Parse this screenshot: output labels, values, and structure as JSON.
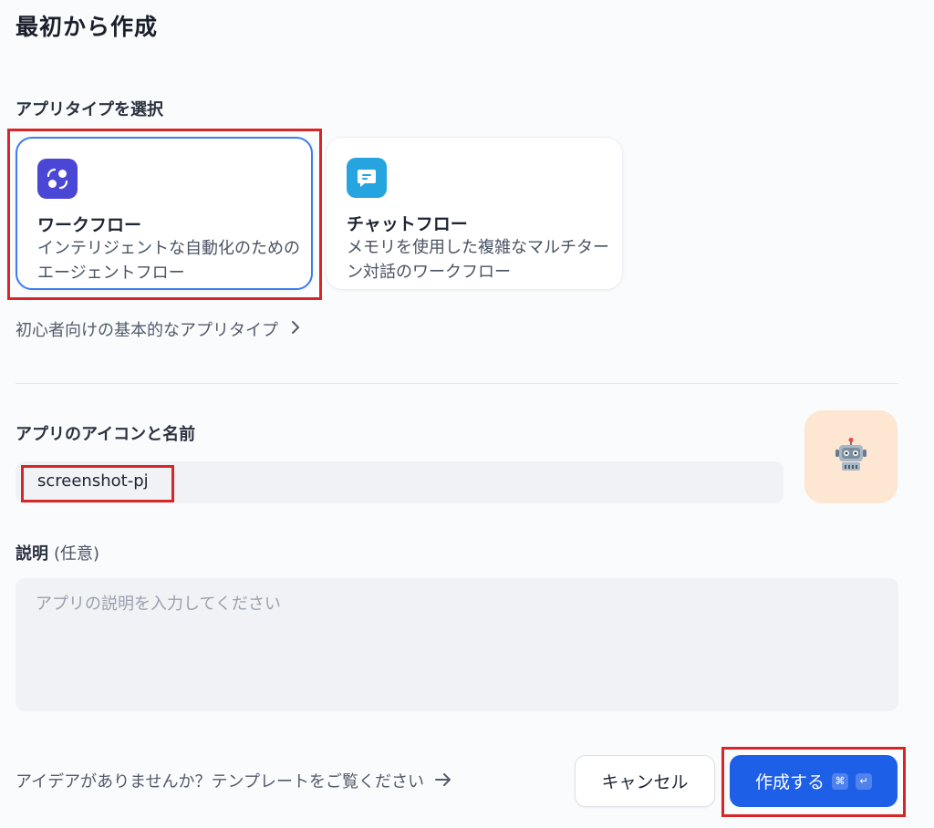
{
  "header": {
    "title": "最初から作成"
  },
  "app_type": {
    "label": "アプリタイプを選択",
    "cards": [
      {
        "name": "ワークフロー",
        "desc": "インテリジェントな自動化のためのエージェントフロー",
        "icon": "workflow-icon",
        "selected": true
      },
      {
        "name": "チャットフロー",
        "desc": "メモリを使用した複雑なマルチターン対話のワークフロー",
        "icon": "chat-bubble-icon",
        "selected": false
      }
    ],
    "basic_link": "初心者向けの基本的なアプリタイプ"
  },
  "app_name": {
    "label": "アプリのアイコンと名前",
    "value": "screenshot-pj",
    "icon": "robot-icon"
  },
  "description": {
    "label": "説明",
    "optional": "(任意)",
    "placeholder": "アプリの説明を入力してください"
  },
  "footer": {
    "template_link": "アイデアがありませんか？テンプレートをご覧ください",
    "cancel_label": "キャンセル",
    "create_label": "作成する",
    "shortcut_keys": [
      "⌘",
      "↵"
    ]
  },
  "colors": {
    "primary": "#1e5fe8",
    "highlight": "#d82628",
    "selected_border": "#3c7cf0"
  }
}
